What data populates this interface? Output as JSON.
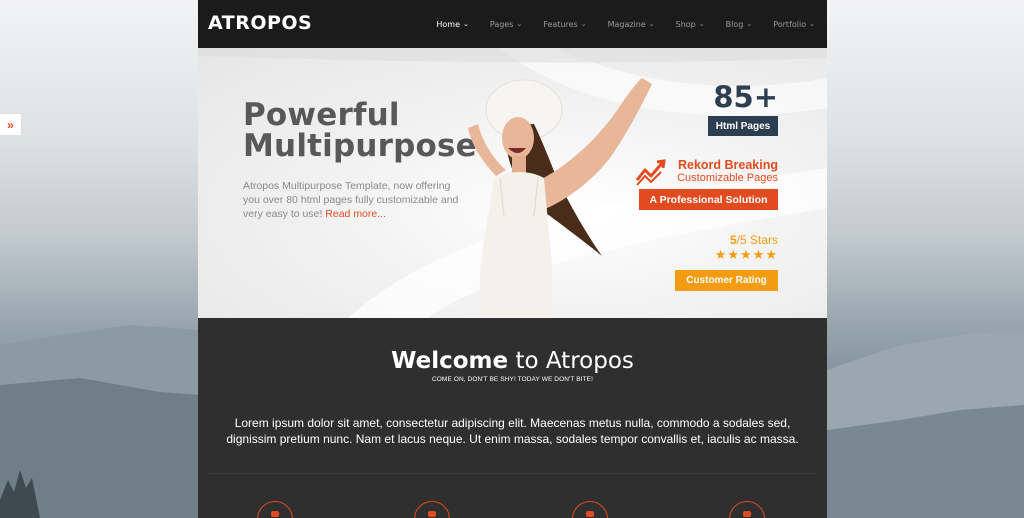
{
  "theme": {
    "accent": "#e24b1f",
    "navy": "#2c3e50",
    "gold": "#f39c12",
    "header_bg": "#1b1b1b",
    "section_bg": "#2f2f2f"
  },
  "side_toggle": {
    "label": "»"
  },
  "header": {
    "logo": "ATROPOS",
    "nav": [
      {
        "label": "Home",
        "active": true
      },
      {
        "label": "Pages"
      },
      {
        "label": "Features"
      },
      {
        "label": "Magazine"
      },
      {
        "label": "Shop"
      },
      {
        "label": "Blog"
      },
      {
        "label": "Portfolio"
      }
    ]
  },
  "hero": {
    "title_line1": "Powerful",
    "title_line2": "Multipurpose",
    "description": "Atropos Multipurpose Template, now offering you over 80 html pages fully customizable and very easy to use!",
    "read_more": "Read more...",
    "pages_count": "85+",
    "pages_label": "Html Pages",
    "rekord_title": "Rekord Breaking",
    "rekord_sub": "Customizable Pages",
    "pro_label": "A Professional Solution",
    "stars_value": "5",
    "stars_suffix": "/5 Stars",
    "stars": "★★★★★",
    "rating": 5,
    "rating_label": "Customer Rating"
  },
  "welcome": {
    "title_bold": "Welcome",
    "title_rest": "to Atropos",
    "subtitle": "COME ON, DON'T BE SHY! TODAY WE DON'T BITE!",
    "text": "Lorem ipsum dolor sit amet, consectetur adipiscing elit. Maecenas metus nulla, commodo a sodales sed, dignissim pretium nunc. Nam et lacus neque. Ut enim massa, sodales tempor convallis et, iaculis ac massa.",
    "features": [
      {
        "icon": "users-icon"
      },
      {
        "icon": "mobile-icon"
      },
      {
        "icon": "briefcase-icon"
      },
      {
        "icon": "gears-icon"
      }
    ]
  }
}
